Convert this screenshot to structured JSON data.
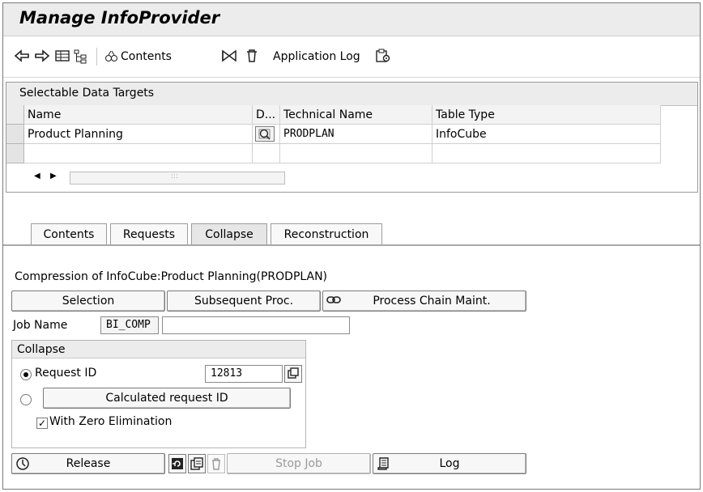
{
  "window": {
    "title": "Manage InfoProvider"
  },
  "toolbar": {
    "back_icon": "arrow-left-icon",
    "forward_icon": "arrow-right-icon",
    "contents_label": "Contents",
    "application_log_label": "Application Log"
  },
  "data_targets": {
    "title": "Selectable Data Targets",
    "columns": [
      "Name",
      "D...",
      "Technical Name",
      "Table Type"
    ],
    "rows": [
      {
        "name": "Product Planning",
        "technical_name": "PRODPLAN",
        "table_type": "InfoCube"
      }
    ]
  },
  "tabs": [
    {
      "label": "Contents",
      "active": false
    },
    {
      "label": "Requests",
      "active": false
    },
    {
      "label": "Collapse",
      "active": true
    },
    {
      "label": "Reconstruction",
      "active": false
    }
  ],
  "collapse_tab": {
    "heading": "Compression of InfoCube:Product Planning(PRODPLAN)",
    "selection_label": "Selection",
    "subsequent_label": "Subsequent Proc.",
    "process_chain_label": "Process Chain Maint.",
    "job_name_label": "Job Name",
    "job_name_value": "BI_COMP",
    "job_name_extra": "",
    "group_title": "Collapse",
    "request_id_label": "Request ID",
    "request_id_value": "12813",
    "request_id_selected": true,
    "calculated_request_label": "Calculated request ID",
    "zero_elimination_label": "With Zero Elimination",
    "zero_elimination_checked": true,
    "release_label": "Release",
    "stop_job_label": "Stop Job",
    "log_label": "Log"
  }
}
